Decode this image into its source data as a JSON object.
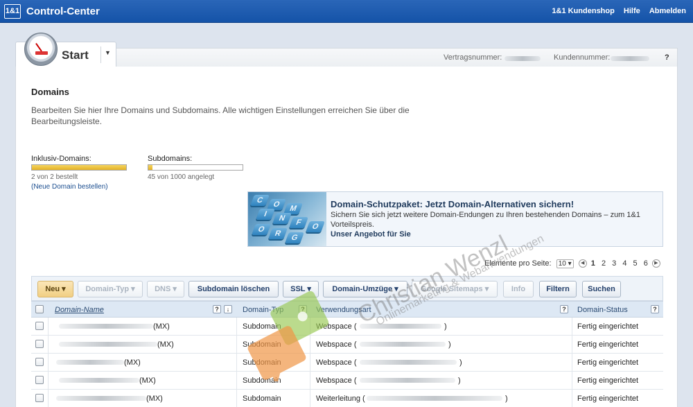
{
  "header": {
    "logo": "1&1",
    "title": "Control-Center",
    "links": [
      "1&1 Kundenshop",
      "Hilfe",
      "Abmelden"
    ]
  },
  "tab": {
    "label": "Start",
    "dropdown_icon": "▼"
  },
  "strip": {
    "contract_label": "Vertragsnummer:",
    "customer_label": "Kundennummer:",
    "help": "?"
  },
  "domains": {
    "title": "Domains",
    "description": "Bearbeiten Sie hier Ihre Domains und Subdomains. Alle wichtigen Einstellungen erreichen Sie über die Bearbeitungsleiste.",
    "inclusive": {
      "label": "Inklusiv-Domains:",
      "sub": "2 von 2 bestellt",
      "fill": 1.0,
      "link": "(Neue Domain bestellen)"
    },
    "subdomains": {
      "label": "Subdomains:",
      "sub": "45 von 1000 angelegt",
      "fill": 0.045
    }
  },
  "promo": {
    "title": "Domain-Schutzpaket: Jetzt Domain-Alternativen sichern!",
    "text": "Sichern Sie sich jetzt weitere Domain-Endungen zu Ihren bestehenden Domains – zum 1&1 Vorteilspreis.",
    "link": "Unser Angebot für Sie",
    "keys": [
      "C",
      "O",
      "M",
      "I",
      "N",
      "F",
      "O",
      "O",
      "R",
      "G"
    ]
  },
  "pager": {
    "label": "Elemente pro Seite:",
    "per_page": "10",
    "pages": [
      "1",
      "2",
      "3",
      "4",
      "5",
      "6"
    ],
    "current": "1"
  },
  "toolbar": {
    "new": "Neu",
    "domain_type": "Domain-Typ",
    "dns": "DNS",
    "delete_sub": "Subdomain löschen",
    "ssl": "SSL",
    "moves": "Domain-Umzüge",
    "sitemaps": "Google Sitemaps",
    "info": "Info",
    "filter": "Filtern",
    "search": "Suchen"
  },
  "table": {
    "columns": [
      "Domain-Name",
      "Domain-Typ",
      "Verwendungsart",
      "Domain-Status"
    ],
    "rows": [
      {
        "name_suffix": "(MX)",
        "type": "Subdomain",
        "usage": "Webspace (",
        "usage_end": ")",
        "status": "Fertig eingerichtet"
      },
      {
        "name_suffix": "(MX)",
        "type": "Subdomain",
        "usage": "Webspace (",
        "usage_end": ")",
        "status": "Fertig eingerichtet"
      },
      {
        "name_suffix": "(MX)",
        "type": "Subdomain",
        "usage": "Webspace (",
        "usage_end": ")",
        "status": "Fertig eingerichtet"
      },
      {
        "name_suffix": "(MX)",
        "type": "Subdomain",
        "usage": "Webspace (",
        "usage_end": ")",
        "status": "Fertig eingerichtet"
      },
      {
        "name_suffix": "(MX)",
        "type": "Subdomain",
        "usage": "Weiterleitung (",
        "usage_end": ")",
        "status": "Fertig eingerichtet"
      }
    ]
  },
  "watermark": {
    "name": "Christian Wenzl",
    "tagline": "Onlinemarketing & Webanwendungen"
  },
  "colors": {
    "header_blue": "#1553a8",
    "bar_yellow": "#e5b225",
    "toolbar_new": "#f1cf83"
  }
}
